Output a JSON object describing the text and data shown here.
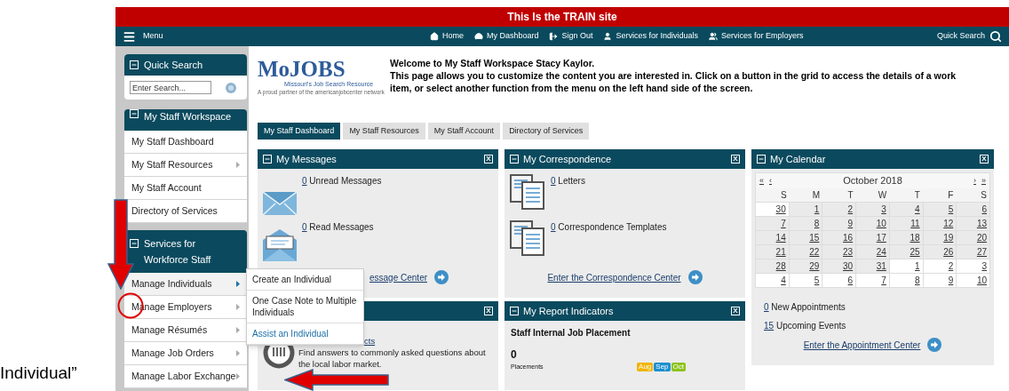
{
  "caption": "Individual”",
  "banner": "This Is the TRAIN site",
  "navbar": {
    "menu_label": "Menu",
    "quick_search": "Quick Search",
    "links": [
      {
        "label": "Home",
        "kind": "home"
      },
      {
        "label": "My Dashboard",
        "kind": "dashboard"
      },
      {
        "label": "Sign Out",
        "kind": "signout"
      },
      {
        "label": "Services for Individuals",
        "kind": "person"
      },
      {
        "label": "Services for Employers",
        "kind": "people"
      }
    ]
  },
  "sidebar": {
    "quick_search": {
      "title": "Quick Search",
      "placeholder": "Enter Search..."
    },
    "sections": [
      {
        "title": "My Staff Workspace",
        "items": [
          {
            "label": "My Staff Dashboard",
            "has_submenu": false
          },
          {
            "label": "My Staff Resources",
            "has_submenu": true
          },
          {
            "label": "My Staff Account",
            "has_submenu": false
          },
          {
            "label": "Directory of Services",
            "has_submenu": false
          }
        ]
      },
      {
        "title": "Services for Workforce Staff",
        "items": [
          {
            "label": "Manage Individuals",
            "has_submenu": true,
            "selected": true
          },
          {
            "label": "Manage Employers",
            "has_submenu": true,
            "selected": false
          },
          {
            "label": "Manage Résumés",
            "has_submenu": true,
            "selected": false
          },
          {
            "label": "Manage Job Orders",
            "has_submenu": true,
            "selected": false
          },
          {
            "label": "Manage Labor Exchange",
            "has_submenu": true,
            "selected": false
          }
        ]
      }
    ]
  },
  "submenu": [
    {
      "label": "Create an Individual",
      "highlighted": false
    },
    {
      "label": "One Case Note to Multiple Individuals",
      "highlighted": false
    },
    {
      "label": "Assist an Individual",
      "highlighted": true
    }
  ],
  "header": {
    "logo": {
      "name": "MoJOBS",
      "tagline": "Missouri's Job Search Resource",
      "partner": "A proud partner of the americanjobcenter network"
    },
    "welcome": "Welcome to My Staff Workspace Stacy Kaylor.",
    "intro": "This page allows you to customize the content you are interested in. Click on a button in the grid to access the details of a work item, or select another function from the menu on the left hand side of the screen."
  },
  "tabs": [
    {
      "label": "My Staff Dashboard",
      "selected": true
    },
    {
      "label": "My Staff Resources",
      "selected": false
    },
    {
      "label": "My Staff Account",
      "selected": false
    },
    {
      "label": "Directory of Services",
      "selected": false
    }
  ],
  "messages": {
    "title": "My Messages",
    "close": "X",
    "items": [
      {
        "count": "0",
        "label": "Unread Messages",
        "kind": "closed"
      },
      {
        "count": "0",
        "label": "Read Messages",
        "kind": "open"
      }
    ],
    "link": "essage Center"
  },
  "correspondence": {
    "title": "My Correspondence",
    "close": "X",
    "items": [
      {
        "count": "0",
        "label": "Letters"
      },
      {
        "count": "0",
        "label": "Correspondence Templates"
      }
    ],
    "link": "Enter the Correspondence Center"
  },
  "calendar": {
    "title": "My Calendar",
    "close": "X",
    "nav": [
      "«",
      "‹",
      "›",
      "»"
    ],
    "month": "October 2018",
    "weekdays": [
      "S",
      "M",
      "T",
      "W",
      "T",
      "F",
      "S"
    ],
    "weeks": [
      [
        {
          "day": "30",
          "other_month": true
        },
        {
          "day": "1",
          "other_month": false
        },
        {
          "day": "2",
          "other_month": false
        },
        {
          "day": "3",
          "other_month": false
        },
        {
          "day": "4",
          "other_month": false
        },
        {
          "day": "5",
          "other_month": false
        },
        {
          "day": "6",
          "other_month": false
        }
      ],
      [
        {
          "day": "7",
          "other_month": false
        },
        {
          "day": "8",
          "other_month": false
        },
        {
          "day": "9",
          "other_month": false
        },
        {
          "day": "10",
          "other_month": false
        },
        {
          "day": "11",
          "other_month": false
        },
        {
          "day": "12",
          "other_month": false
        },
        {
          "day": "13",
          "other_month": false
        }
      ],
      [
        {
          "day": "14",
          "other_month": false
        },
        {
          "day": "15",
          "other_month": false
        },
        {
          "day": "16",
          "other_month": false
        },
        {
          "day": "17",
          "other_month": false
        },
        {
          "day": "18",
          "other_month": false
        },
        {
          "day": "19",
          "other_month": false
        },
        {
          "day": "20",
          "other_month": false
        }
      ],
      [
        {
          "day": "21",
          "other_month": false
        },
        {
          "day": "22",
          "other_month": false
        },
        {
          "day": "23",
          "other_month": false
        },
        {
          "day": "24",
          "other_month": false
        },
        {
          "day": "25",
          "other_month": false
        },
        {
          "day": "26",
          "other_month": false
        },
        {
          "day": "27",
          "other_month": false
        }
      ],
      [
        {
          "day": "28",
          "other_month": false
        },
        {
          "day": "29",
          "other_month": false
        },
        {
          "day": "30",
          "other_month": false
        },
        {
          "day": "31",
          "other_month": false
        },
        {
          "day": "1",
          "other_month": true
        },
        {
          "day": "2",
          "other_month": true
        },
        {
          "day": "3",
          "other_month": true
        }
      ],
      [
        {
          "day": "4",
          "other_month": true
        },
        {
          "day": "5",
          "other_month": true
        },
        {
          "day": "6",
          "other_month": true
        },
        {
          "day": "7",
          "other_month": true
        },
        {
          "day": "8",
          "other_month": true
        },
        {
          "day": "9",
          "other_month": true
        },
        {
          "day": "10",
          "other_month": true
        }
      ]
    ],
    "appointments": [
      {
        "count": "0",
        "label": "New Appointments"
      },
      {
        "count": "15",
        "label": "Upcoming Events"
      }
    ],
    "link": "Enter the Appointment Center"
  },
  "labor_market": {
    "close": "X",
    "link": "cts",
    "text": "Find answers to commonly asked questions about the local labor market."
  },
  "report": {
    "title": "My Report Indicators",
    "close": "X",
    "indicator": "Staff Internal Job Placement",
    "value": "0",
    "unit": "Placements",
    "badges": [
      {
        "label": "Aug",
        "color": "#f0b400"
      },
      {
        "label": "Sep",
        "color": "#1b8fd0"
      },
      {
        "label": "Oct",
        "color": "#8dc31f"
      }
    ]
  }
}
